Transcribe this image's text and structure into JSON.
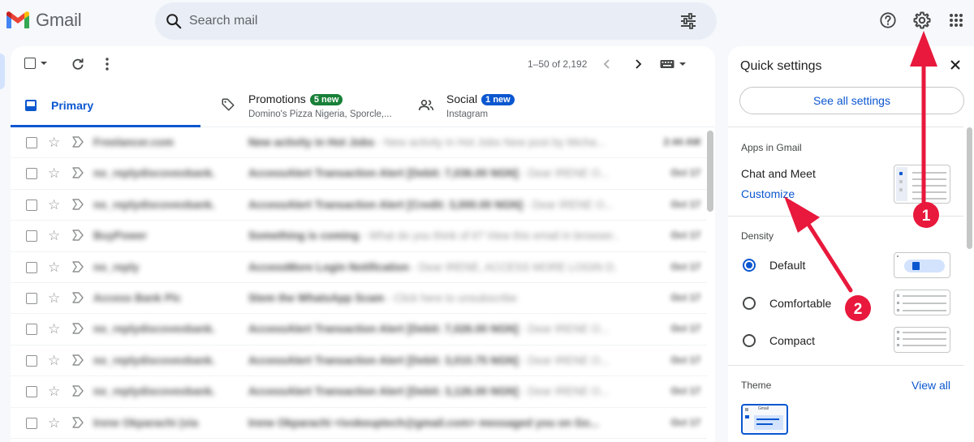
{
  "app": {
    "name": "Gmail"
  },
  "search": {
    "placeholder": "Search mail"
  },
  "toolbar": {
    "pagination": "1–50 of 2,192"
  },
  "tabs": [
    {
      "label": "Primary",
      "badge": "",
      "subtitle": ""
    },
    {
      "label": "Promotions",
      "badge": "5 new",
      "subtitle": "Domino's Pizza Nigeria, Sporcle,..."
    },
    {
      "label": "Social",
      "badge": "1 new",
      "subtitle": "Instagram"
    }
  ],
  "emails": [
    {
      "sender": "Freelancer.com",
      "subject": "New activity in Hot Jobs",
      "snippet": " - New activity in Hot Jobs New post by Micha...",
      "date": "2:44 AM"
    },
    {
      "sender": "no_replydiscoveobank.",
      "subject": "AccessAlert Transaction Alert [Debit: 7,036.00 NGN]",
      "snippet": " - Dear IRENE O...",
      "date": "Oct 17"
    },
    {
      "sender": "no_replydiscoveobank.",
      "subject": "AccessAlert Transaction Alert [Credit: 3,000.00 NGN]",
      "snippet": " - Dear IRENE O...",
      "date": "Oct 17"
    },
    {
      "sender": "BuyPower",
      "subject": "Something is coming",
      "snippet": " - What do you think of it? View this email in browser...",
      "date": "Oct 17"
    },
    {
      "sender": "no_reply",
      "subject": "AccessMore Login Notification",
      "snippet": " - Dear IRENE, ACCESS MORE LOGIN D...",
      "date": "Oct 17"
    },
    {
      "sender": "Access Bank Plc",
      "subject": "Stem the WhatsApp Scam",
      "snippet": " - Click here to unsubscribe",
      "date": "Oct 17"
    },
    {
      "sender": "no_replydiscoveobank.",
      "subject": "AccessAlert Transaction Alert [Debit: 7,026.00 NGN]",
      "snippet": " - Dear IRENE O...",
      "date": "Oct 17"
    },
    {
      "sender": "no_replydiscoveobank.",
      "subject": "AccessAlert Transaction Alert [Debit: 3,010.75 NGN]",
      "snippet": " - Dear IRENE O...",
      "date": "Oct 17"
    },
    {
      "sender": "no_replydiscoveobank.",
      "subject": "AccessAlert Transaction Alert [Debit: 3,126.00 NGN]",
      "snippet": " - Dear IRENE O...",
      "date": "Oct 17"
    },
    {
      "sender": "Irene Okparachi (via",
      "subject": "Irene Okparachi <ivokeuptech@gmail.com> messaged you on Go...",
      "snippet": "",
      "date": "Oct 17"
    }
  ],
  "quick_settings": {
    "title": "Quick settings",
    "see_all": "See all settings",
    "apps_section": "Apps in Gmail",
    "chat_meet": "Chat and Meet",
    "customize": "Customize",
    "density_section": "Density",
    "density_options": [
      {
        "label": "Default",
        "selected": true
      },
      {
        "label": "Comfortable",
        "selected": false
      },
      {
        "label": "Compact",
        "selected": false
      }
    ],
    "theme_section": "Theme",
    "view_all": "View all",
    "theme_thumb_text": "Gmail"
  },
  "annotations": {
    "callout_1": "1",
    "callout_2": "2"
  },
  "colors": {
    "accent": "#0b57d0",
    "badge_green": "#188038",
    "badge_blue": "#0b57d0",
    "annotation_red": "#e8193c"
  }
}
